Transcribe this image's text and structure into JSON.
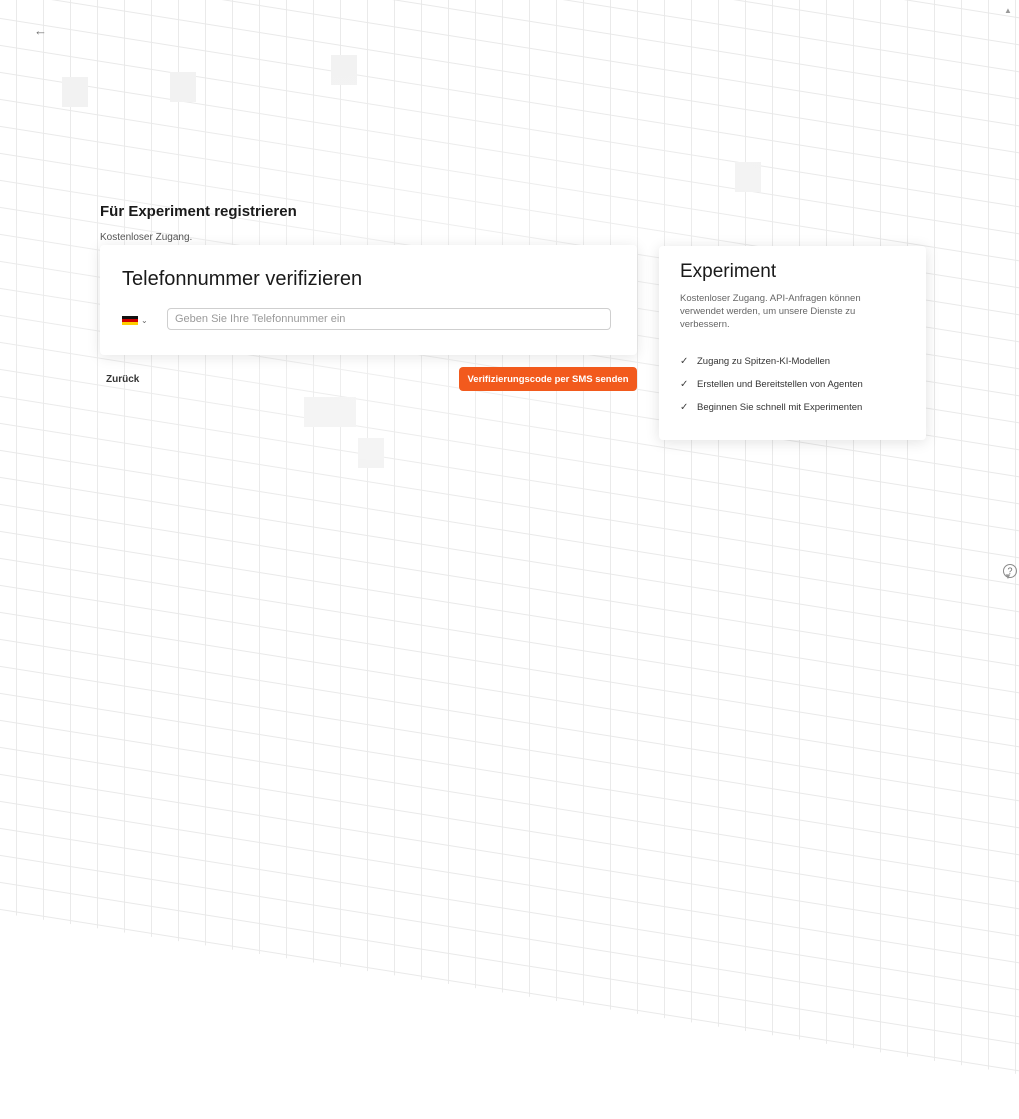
{
  "page": {
    "heading": "Für Experiment registrieren",
    "subheading": "Kostenloser Zugang."
  },
  "verify": {
    "title": "Telefonnummer verifizieren",
    "country_flag": "germany-flag",
    "phone_placeholder": "Geben Sie Ihre Telefonnummer ein",
    "phone_value": ""
  },
  "actions": {
    "back_label": "Zurück",
    "send_label": "Verifizierungscode per SMS senden"
  },
  "info": {
    "title": "Experiment",
    "description": "Kostenloser Zugang. API-Anfragen können verwendet werden, um unsere Dienste zu verbessern.",
    "features": [
      "Zugang zu Spitzen-KI-Modellen",
      "Erstellen und Bereitstellen von Agenten",
      "Beginnen Sie schnell mit Experimenten"
    ]
  },
  "colors": {
    "accent": "#f25a1d",
    "background": "#ffffff",
    "grid": "#e9e9e9"
  }
}
